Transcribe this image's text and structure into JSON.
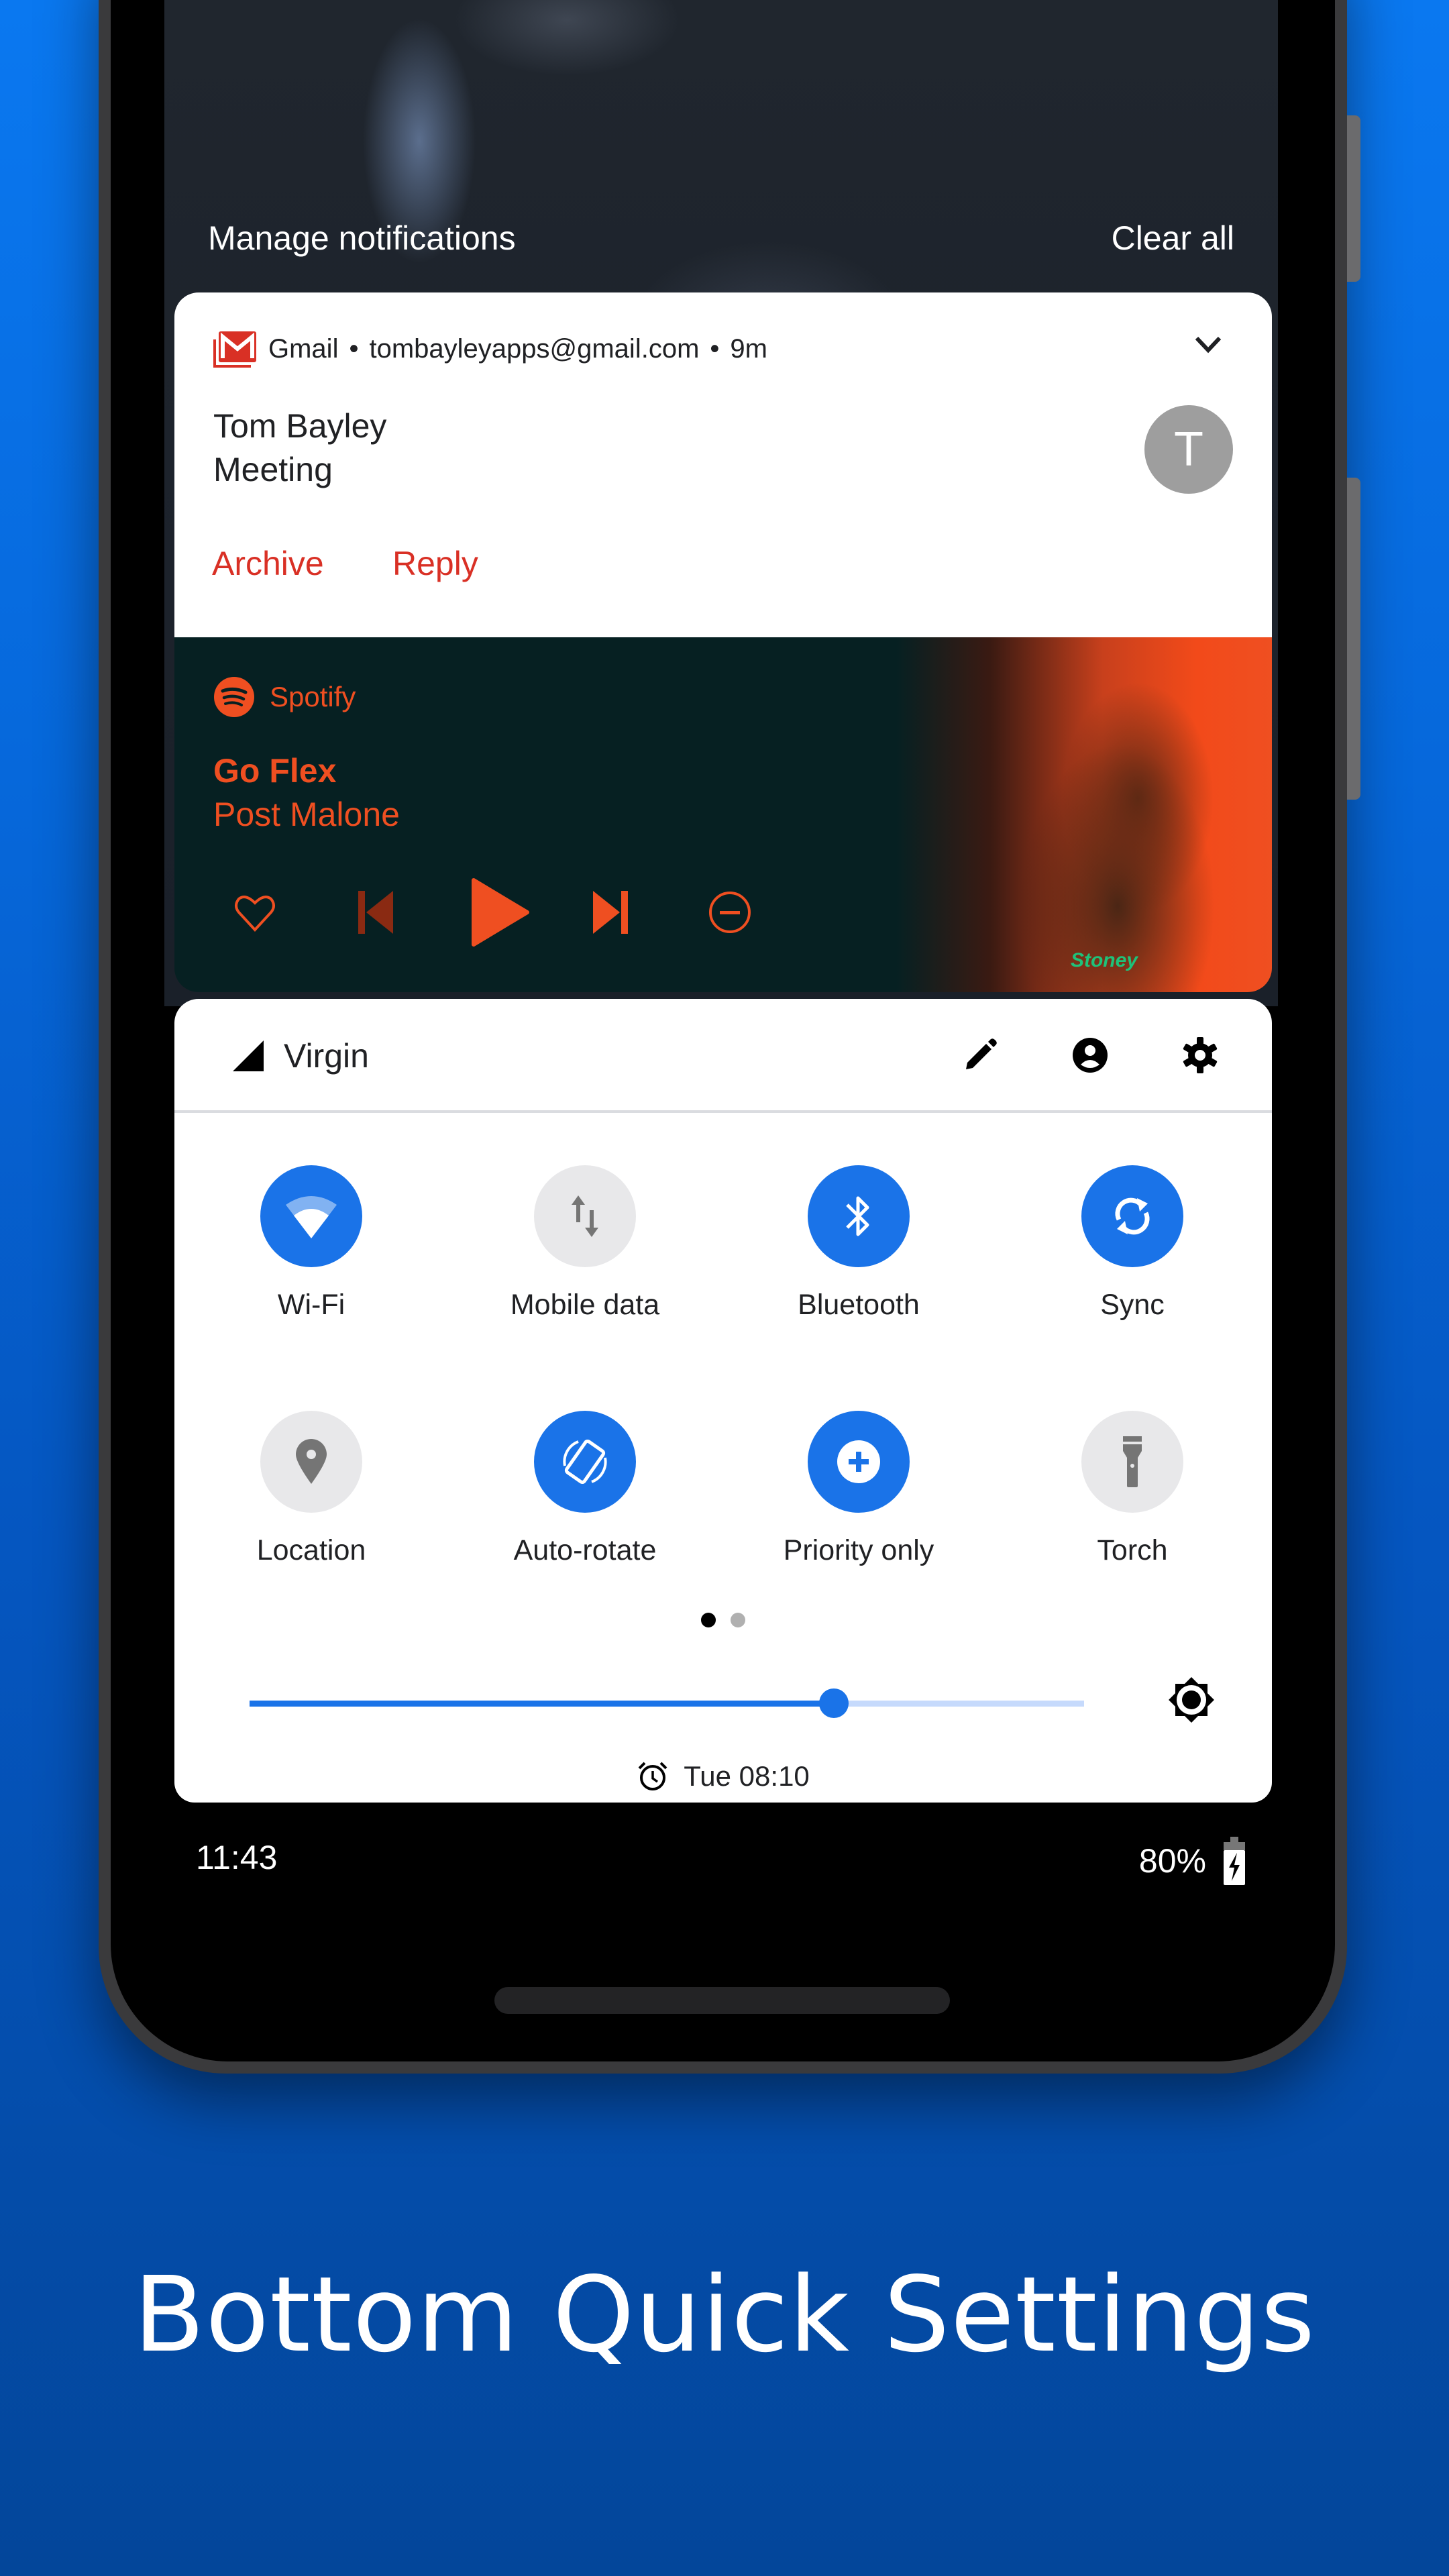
{
  "notification_shade": {
    "manage_label": "Manage notifications",
    "clear_all_label": "Clear all"
  },
  "gmail_notification": {
    "app_name": "Gmail",
    "separator": "•",
    "account": "tombayleyapps@gmail.com",
    "time": "9m",
    "sender": "Tom Bayley",
    "subject": "Meeting",
    "avatar_letter": "T",
    "actions": [
      "Archive",
      "Reply"
    ],
    "accent_color": "#d93025"
  },
  "media_notification": {
    "app_name": "Spotify",
    "track_title": "Go Flex",
    "artist": "Post Malone",
    "album_tag": "Stoney",
    "playback_state": "paused",
    "controls": [
      "like",
      "previous",
      "play",
      "next",
      "remove"
    ],
    "accent_color": "#ef4f21"
  },
  "quick_settings": {
    "carrier": "Virgin",
    "header_icons": [
      "edit-icon",
      "user-icon",
      "settings-icon"
    ],
    "tiles": [
      {
        "label": "Wi-Fi",
        "icon": "wifi-icon",
        "active": true
      },
      {
        "label": "Mobile data",
        "icon": "mobile-data-icon",
        "active": false
      },
      {
        "label": "Bluetooth",
        "icon": "bluetooth-icon",
        "active": true
      },
      {
        "label": "Sync",
        "icon": "sync-icon",
        "active": true
      },
      {
        "label": "Location",
        "icon": "location-icon",
        "active": false
      },
      {
        "label": "Auto-rotate",
        "icon": "auto-rotate-icon",
        "active": true
      },
      {
        "label": "Priority only",
        "icon": "priority-icon",
        "active": true
      },
      {
        "label": "Torch",
        "icon": "torch-icon",
        "active": false
      }
    ],
    "page_index": 1,
    "page_count": 2,
    "brightness": 0.7,
    "alarm": "Tue 08:10",
    "active_color": "#1a73e8"
  },
  "status_bar": {
    "time": "11:43",
    "battery": "80%",
    "charging": true
  },
  "promo": {
    "title": "Bottom Quick Settings"
  }
}
